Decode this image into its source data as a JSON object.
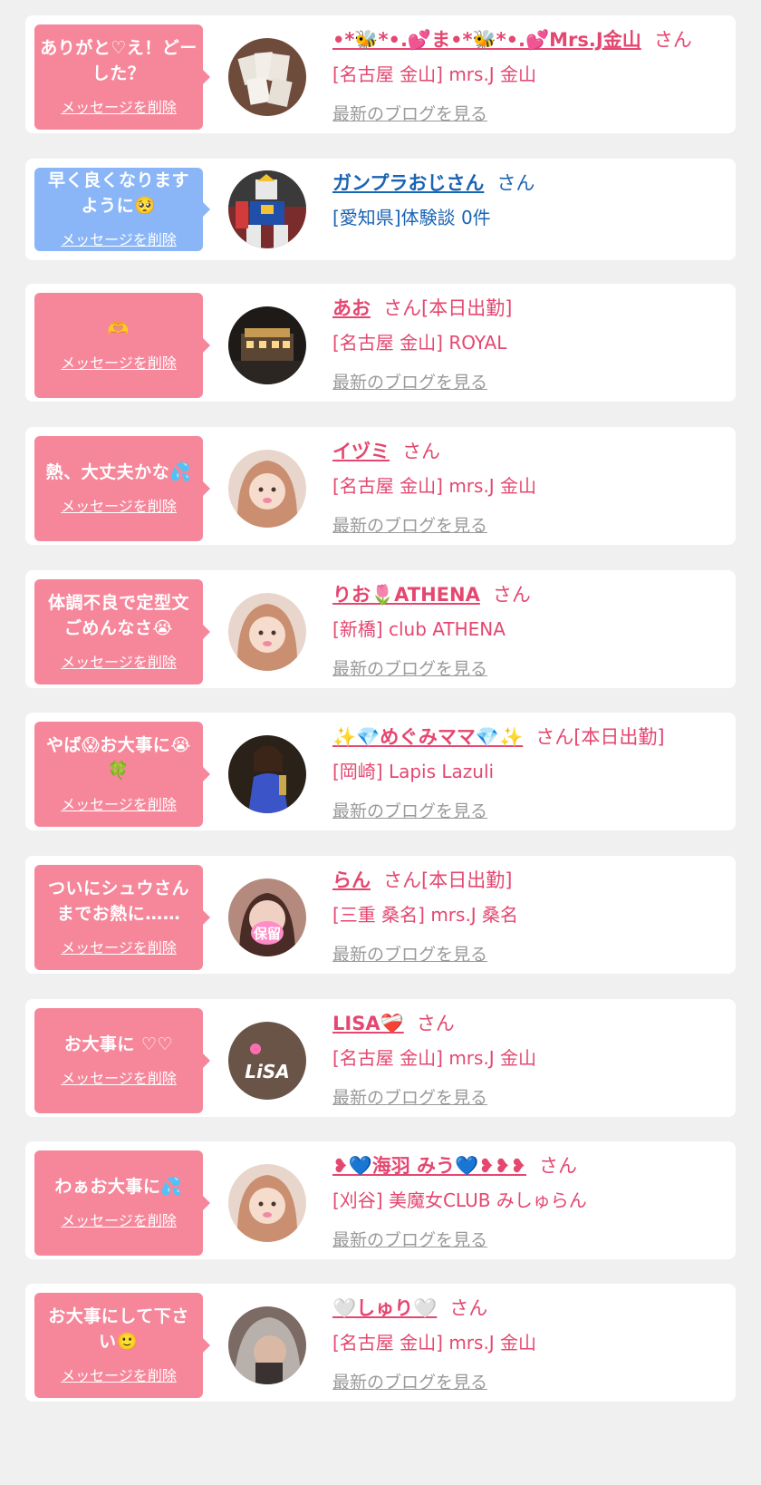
{
  "colors": {
    "pink": "#e44770",
    "blue": "#1a64b4",
    "bubble_pink": "#f6879b",
    "bubble_blue": "#8ab6f8",
    "gray_link": "#9a9a9a"
  },
  "delete_label": "メッセージを削除",
  "blog_label": "最新のブログを見る",
  "san_label": "さん",
  "cards": [
    {
      "message": "ありがと♡え！どーした？",
      "name": "•*🐝*•.💕ま•*🐝*•.💕Mrs.J金山",
      "suffix": "さん",
      "store": "[名古屋 金山] mrs.J 金山",
      "blog": "最新のブログを見る",
      "bubble_color": "#f6879b",
      "text_color": "#e44770",
      "avatar_icon": "cards-photo"
    },
    {
      "message": "早く良くなりますように🥺",
      "name": "ガンプラおじさん",
      "suffix": "さん",
      "store": "[愛知県]体験談 0件",
      "blog": "",
      "bubble_color": "#8ab6f8",
      "text_color": "#1a64b4",
      "avatar_icon": "robot-figure-photo"
    },
    {
      "message": "🫶",
      "name": "あお",
      "suffix": "さん[本日出勤]",
      "store": "[名古屋 金山] ROYAL",
      "blog": "最新のブログを見る",
      "bubble_color": "#f6879b",
      "text_color": "#e44770",
      "avatar_icon": "night-building-photo"
    },
    {
      "message": "熱、大丈夫かな💦",
      "name": "イヅミ",
      "suffix": "さん",
      "store": "[名古屋 金山] mrs.J 金山",
      "blog": "最新のブログを見る",
      "bubble_color": "#f6879b",
      "text_color": "#e44770",
      "avatar_icon": "woman-portrait-photo"
    },
    {
      "message": "体調不良で定型文ごめんなさ😭",
      "name": "りお🌷ATHENA",
      "suffix": "さん",
      "store": "[新橋] club ATHENA",
      "blog": "最新のブログを見る",
      "bubble_color": "#f6879b",
      "text_color": "#e44770",
      "avatar_icon": "woman-portrait-photo"
    },
    {
      "message": "やば😱お大事に😭🍀",
      "name": "✨💎めぐみママ💎✨",
      "suffix": "さん[本日出勤]",
      "store": "[岡崎] Lapis Lazuli",
      "blog": "最新のブログを見る",
      "bubble_color": "#f6879b",
      "text_color": "#e44770",
      "avatar_icon": "woman-dress-photo"
    },
    {
      "message": "ついにシュウさんまでお熱に……",
      "name": "らん",
      "suffix": "さん[本日出勤]",
      "store": "[三重 桑名] mrs.J 桑名",
      "blog": "最新のブログを見る",
      "bubble_color": "#f6879b",
      "text_color": "#e44770",
      "avatar_icon": "woman-hoshu-photo",
      "avatar_text": "保留"
    },
    {
      "message": "お大事に ♡♡",
      "name": "LISA❤️‍🩹",
      "suffix": "さん",
      "store": "[名古屋 金山] mrs.J 金山",
      "blog": "最新のブログを見る",
      "bubble_color": "#f6879b",
      "text_color": "#e44770",
      "avatar_icon": "lisa-logo-photo",
      "avatar_text": "LiSA"
    },
    {
      "message": "わぁお大事に💦",
      "name": "❥💙海羽 みう💙❥❥❥",
      "suffix": "さん",
      "store": "[刈谷] 美魔女CLUB みしゅらん",
      "blog": "最新のブログを見る",
      "bubble_color": "#f6879b",
      "text_color": "#e44770",
      "avatar_icon": "woman-portrait-photo"
    },
    {
      "message": "お大事にして下さい🙂",
      "name": "🤍しゅり🤍",
      "suffix": "さん",
      "store": "[名古屋 金山] mrs.J 金山",
      "blog": "最新のブログを見る",
      "bubble_color": "#f6879b",
      "text_color": "#e44770",
      "avatar_icon": "woman-hair-photo"
    }
  ]
}
